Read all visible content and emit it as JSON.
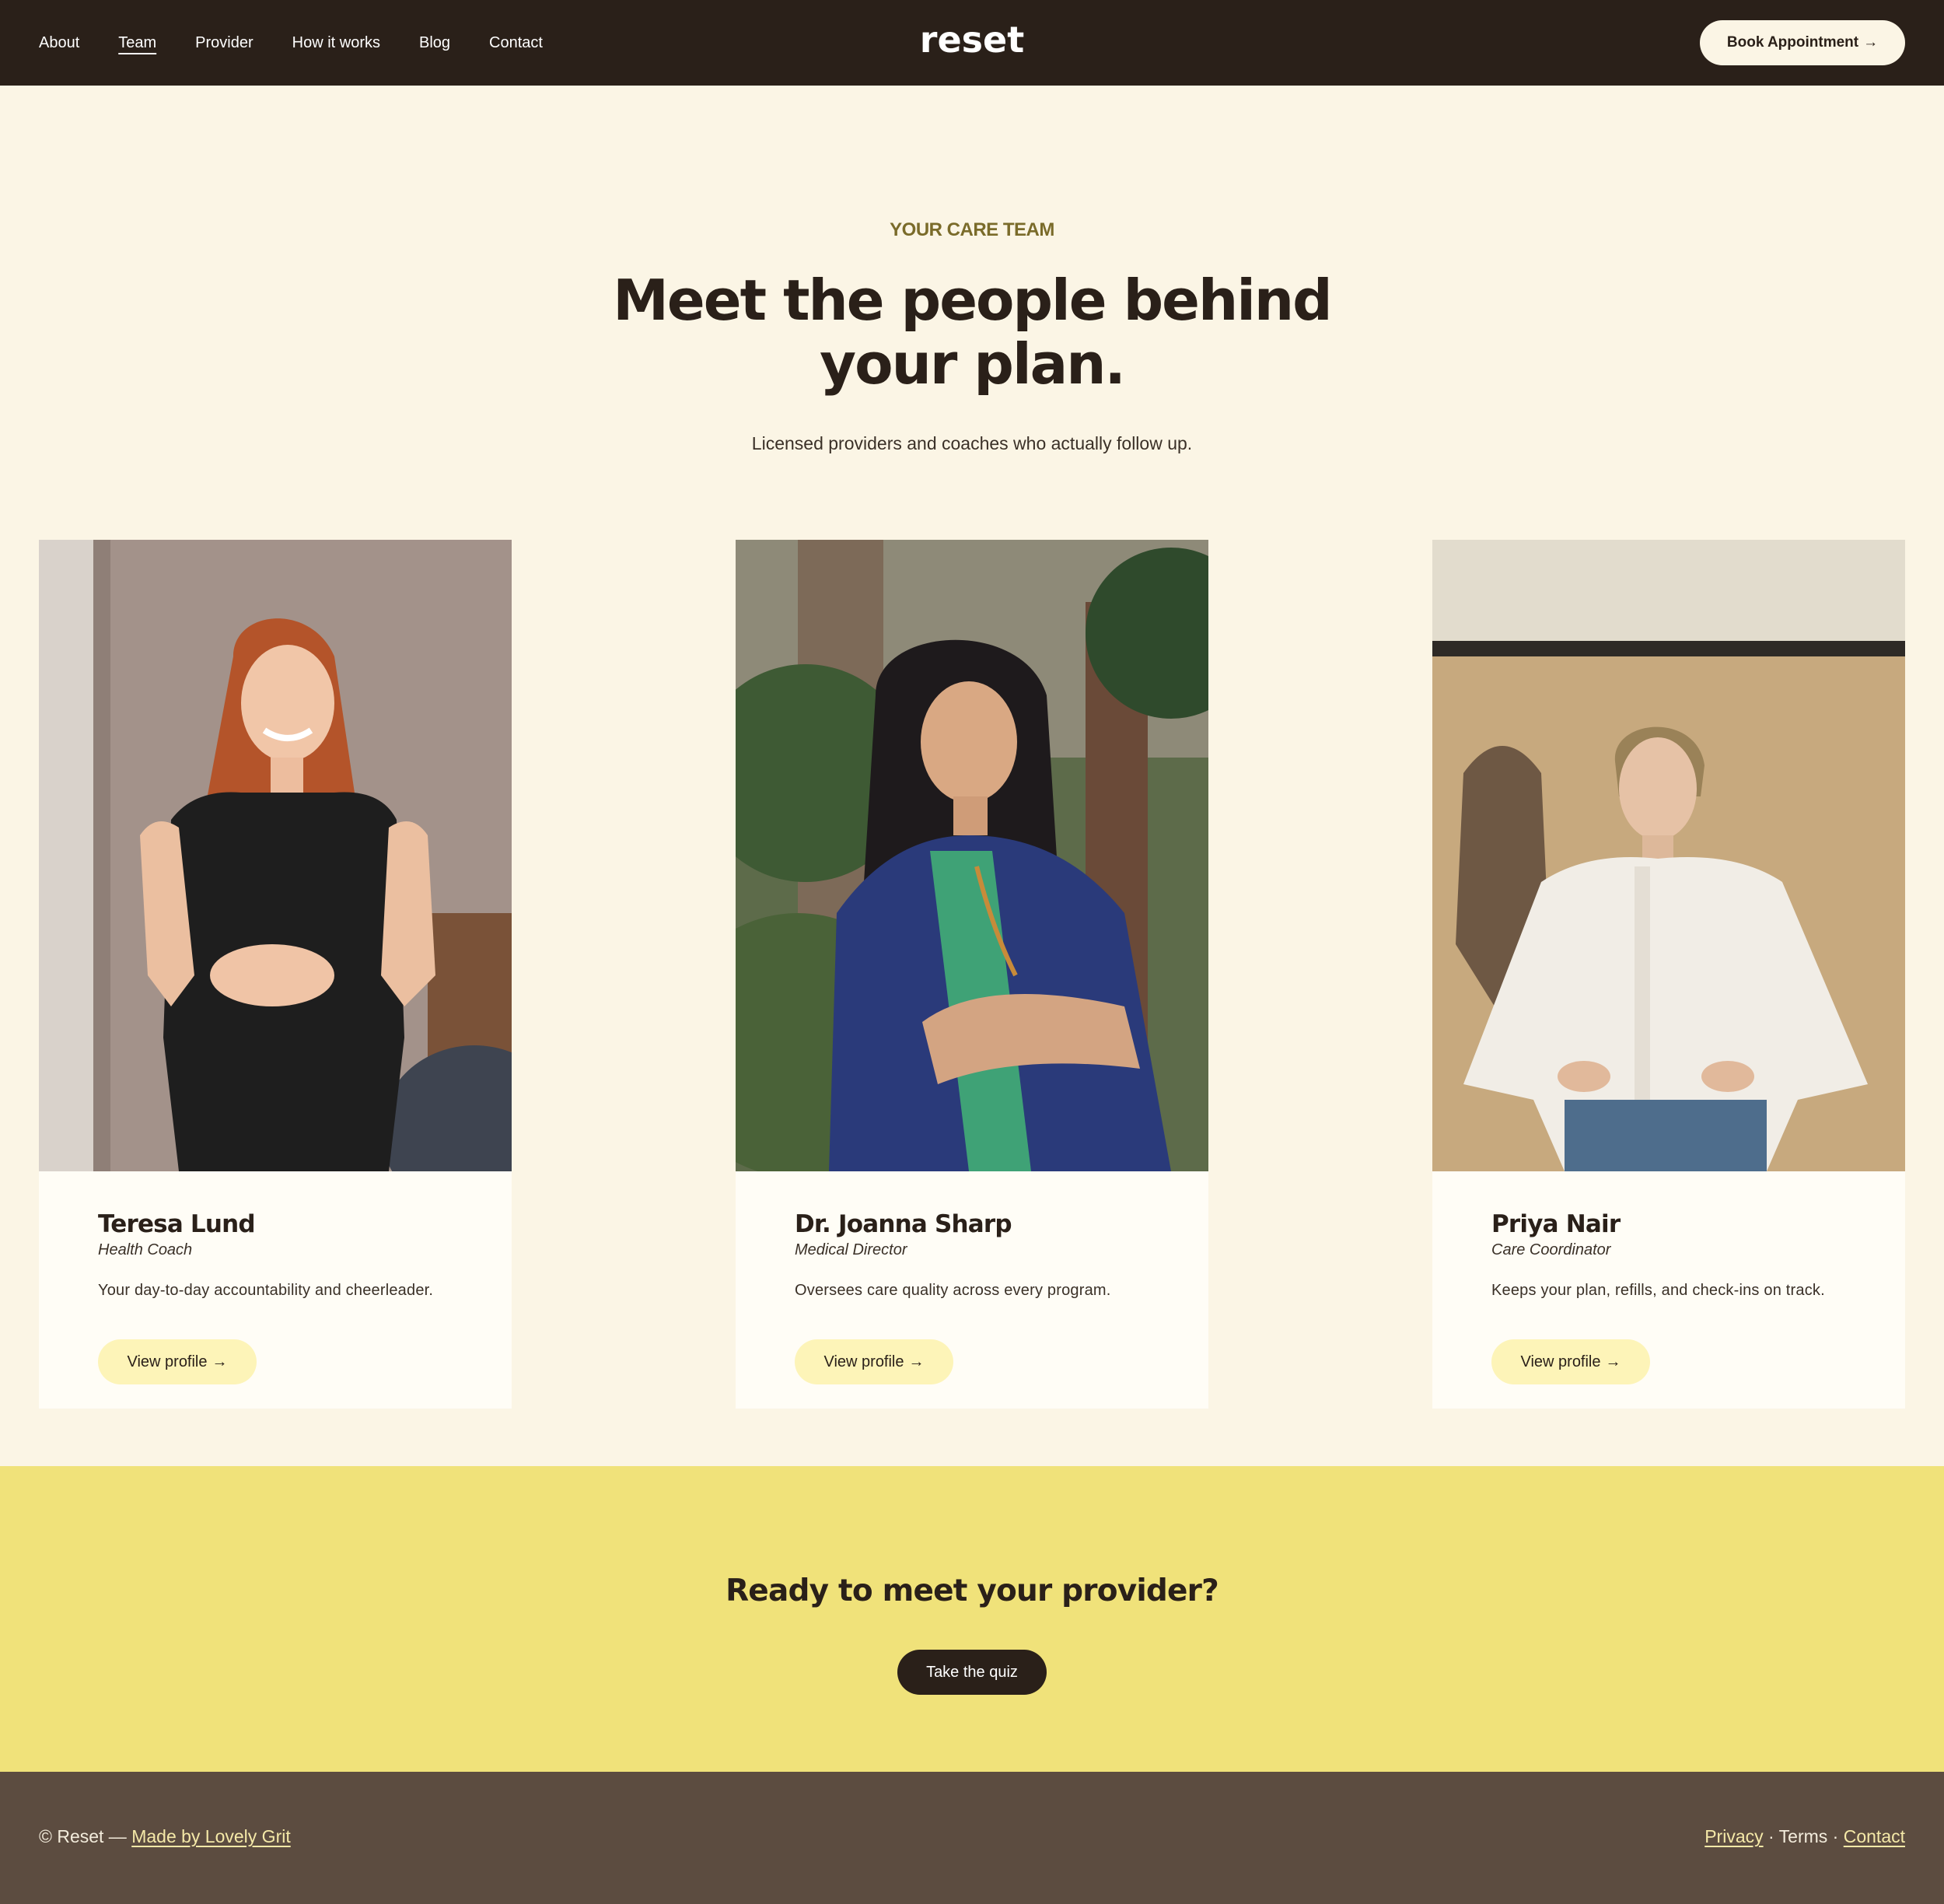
{
  "nav": {
    "items": [
      {
        "label": "About",
        "active": false
      },
      {
        "label": "Team",
        "active": true
      },
      {
        "label": "Provider",
        "active": false
      },
      {
        "label": "How it works",
        "active": false
      },
      {
        "label": "Blog",
        "active": false
      },
      {
        "label": "Contact",
        "active": false
      }
    ],
    "brand": "reset",
    "book_label": "Book Appointment",
    "book_icon": "arrow-right-icon"
  },
  "hero": {
    "eyebrow": "YOUR CARE TEAM",
    "headline_line1": "Meet the people behind",
    "headline_line2": "your plan.",
    "subline": "Licensed providers and coaches who actually follow up."
  },
  "team": [
    {
      "name": "Teresa Lund",
      "role": "Health Coach",
      "desc": "Your day-to-day accountability and cheerleader.",
      "cta": "View profile"
    },
    {
      "name": "Dr. Joanna Sharp",
      "role": "Medical Director",
      "desc": "Oversees care quality across every program.",
      "cta": "View profile"
    },
    {
      "name": "Priya Nair",
      "role": "Care Coordinator",
      "desc": "Keeps your plan, refills, and check-ins on track.",
      "cta": "View profile"
    }
  ],
  "cta": {
    "title": "Ready to meet your provider?",
    "button": "Take the quiz"
  },
  "footer": {
    "copyright": "© Reset —",
    "made_by": "Made by Lovely Grit",
    "privacy": "Privacy",
    "sep": "·",
    "terms": "Terms",
    "contact": "Contact"
  },
  "colors": {
    "header_bg": "#2A2019",
    "page_bg": "#FBF5E5",
    "card_bg": "#FFFDF6",
    "pill_bg": "#FDF4B8",
    "cta_band": "#F0E27A",
    "footer_bg": "#5C4C40",
    "eyebrow": "#7A6B2A"
  }
}
